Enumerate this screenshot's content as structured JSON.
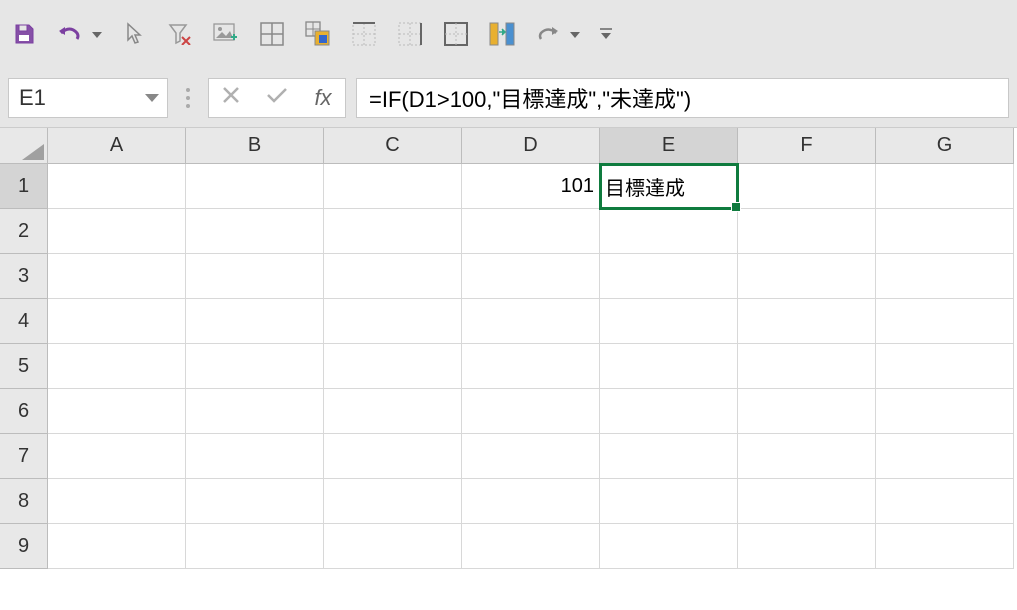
{
  "toolbar": {
    "icons": [
      "save",
      "undo",
      "cursor",
      "filter-clear",
      "image",
      "borders-all",
      "paste-special",
      "border-top",
      "border-right",
      "border-outside",
      "compare",
      "redo",
      "more"
    ]
  },
  "nameBox": {
    "value": "E1"
  },
  "formulaBar": {
    "formula": "=IF(D1>100,\"目標達成\",\"未達成\")",
    "fxLabel": "fx"
  },
  "grid": {
    "columns": [
      "A",
      "B",
      "C",
      "D",
      "E",
      "F",
      "G"
    ],
    "rows": [
      "1",
      "2",
      "3",
      "4",
      "5",
      "6",
      "7",
      "8",
      "9"
    ],
    "selectedCell": "E1",
    "cells": {
      "D1": "101",
      "E1": "目標達成"
    }
  }
}
